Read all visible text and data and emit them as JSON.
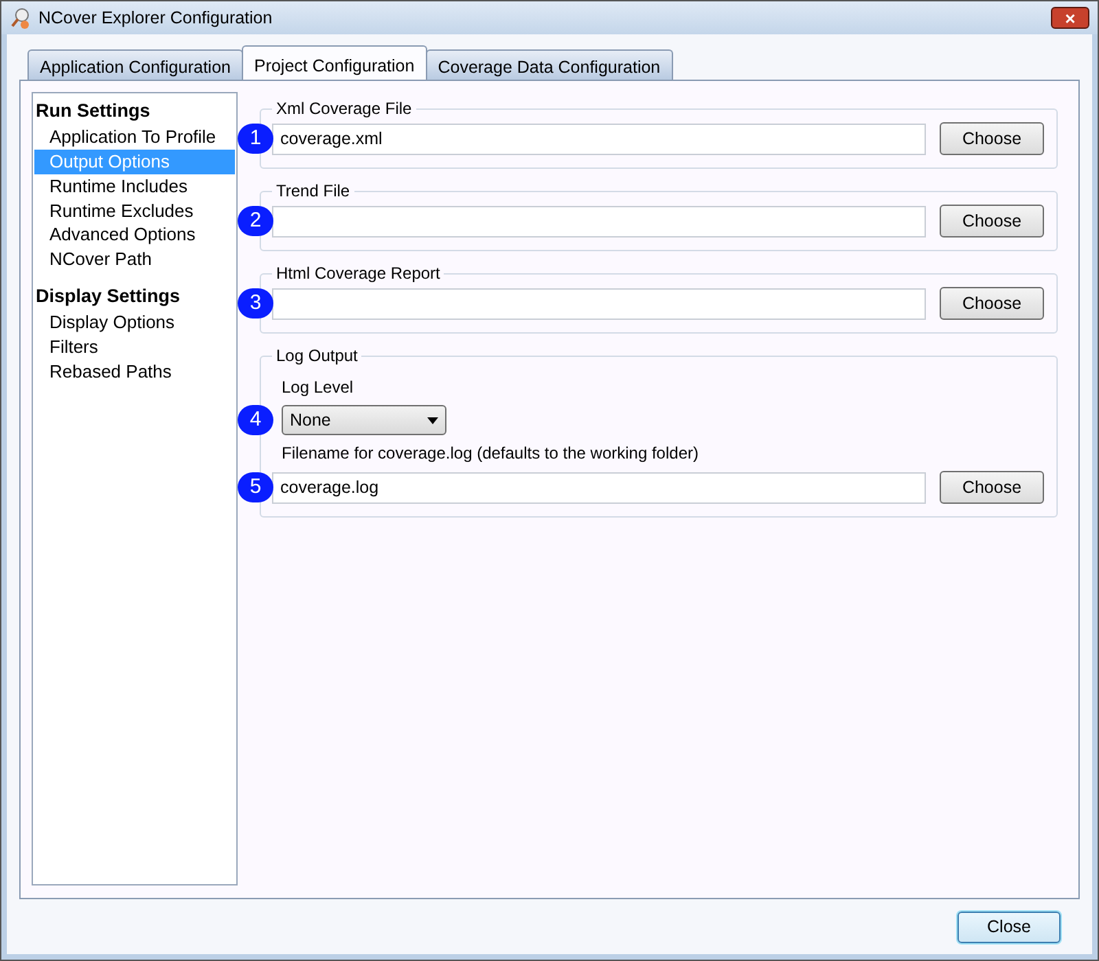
{
  "window": {
    "title": "NCover Explorer Configuration",
    "close": "×"
  },
  "tabs": [
    {
      "label": "Application Configuration",
      "selected": false
    },
    {
      "label": "Project Configuration",
      "selected": true
    },
    {
      "label": "Coverage Data Configuration",
      "selected": false
    }
  ],
  "sidebar": {
    "sections": [
      {
        "heading": "Run Settings",
        "items": [
          {
            "label": "Application To Profile",
            "selected": false
          },
          {
            "label": "Output Options",
            "selected": true
          },
          {
            "label": "Runtime Includes",
            "selected": false
          },
          {
            "label": "Runtime Excludes",
            "selected": false
          },
          {
            "label": "Advanced Options",
            "selected": false
          },
          {
            "label": "NCover Path",
            "selected": false
          }
        ]
      },
      {
        "heading": "Display Settings",
        "items": [
          {
            "label": "Display Options",
            "selected": false
          },
          {
            "label": "Filters",
            "selected": false
          },
          {
            "label": "Rebased Paths",
            "selected": false
          }
        ]
      }
    ]
  },
  "groups": [
    {
      "title": "Xml Coverage File",
      "rows": [
        {
          "kind": "file",
          "badge": "1",
          "value": "coverage.xml",
          "button": "Choose"
        }
      ]
    },
    {
      "title": "Trend File",
      "rows": [
        {
          "kind": "file",
          "badge": "2",
          "button": "Choose"
        }
      ]
    },
    {
      "title": "Html Coverage Report",
      "rows": [
        {
          "kind": "file",
          "badge": "3",
          "button": "Choose"
        }
      ]
    },
    {
      "title": "Log Output",
      "rows": [
        {
          "kind": "label",
          "text": "Log Level"
        },
        {
          "kind": "select",
          "badge": "4",
          "value": "None"
        },
        {
          "kind": "label",
          "text": "Filename for coverage.log (defaults to the working folder)"
        },
        {
          "kind": "file",
          "badge": "5",
          "value": "coverage.log",
          "button": "Choose"
        }
      ]
    }
  ],
  "footer": {
    "button": "Close"
  }
}
